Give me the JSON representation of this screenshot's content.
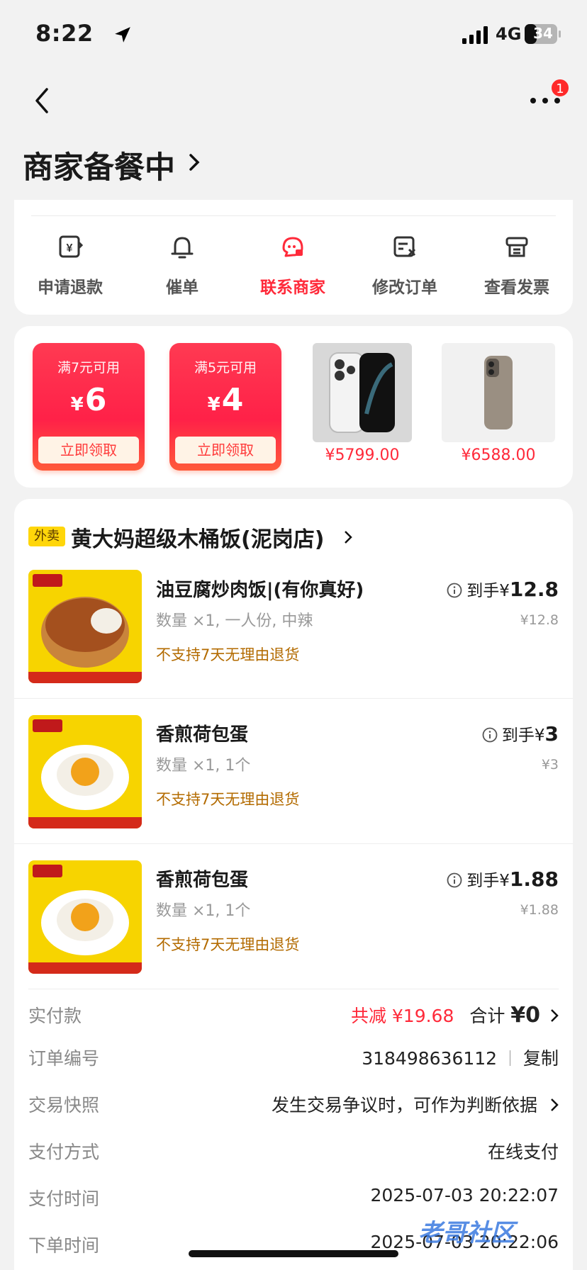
{
  "status_bar": {
    "time": "8:22",
    "network": "4G",
    "battery": "34"
  },
  "nav": {
    "badge_count": "1"
  },
  "header": {
    "title": "商家备餐中"
  },
  "actions": [
    {
      "label": "申请退款",
      "icon": "refund-icon"
    },
    {
      "label": "催单",
      "icon": "bell-icon"
    },
    {
      "label": "联系商家",
      "icon": "merchant-chat-icon"
    },
    {
      "label": "修改订单",
      "icon": "edit-order-icon"
    },
    {
      "label": "查看发票",
      "icon": "invoice-icon"
    }
  ],
  "promo": {
    "coupons": [
      {
        "condition": "满7元可用",
        "currency": "¥",
        "amount": "6",
        "button": "立即领取"
      },
      {
        "condition": "满5元可用",
        "currency": "¥",
        "amount": "4",
        "button": "立即领取"
      }
    ],
    "products": [
      {
        "price": "¥5799.00"
      },
      {
        "price": "¥6588.00"
      }
    ]
  },
  "order": {
    "tag": "外卖",
    "shop_name": "黄大妈超级木桶饭(泥岗店)",
    "items": [
      {
        "name": "油豆腐炒肉饭|(有你真好)",
        "spec": "数量 ×1, 一人份, 中辣",
        "policy": "不支持7天无理由退货",
        "final_label": "到手",
        "final_currency": "¥",
        "final_price": "12.8",
        "price": "¥12.8"
      },
      {
        "name": "香煎荷包蛋",
        "spec": "数量 ×1, 1个",
        "policy": "不支持7天无理由退货",
        "final_label": "到手",
        "final_currency": "¥",
        "final_price": "3",
        "price": "¥3"
      },
      {
        "name": "香煎荷包蛋",
        "spec": "数量 ×1, 1个",
        "policy": "不支持7天无理由退货",
        "final_label": "到手",
        "final_currency": "¥",
        "final_price": "1.88",
        "price": "¥1.88"
      }
    ],
    "details": {
      "paid_label": "实付款",
      "discount_text": "共减 ¥19.68",
      "total_label": "合计",
      "total_value": "¥0",
      "order_no_label": "订单编号",
      "order_no": "318498636112",
      "copy_label": "复制",
      "snapshot_label": "交易快照",
      "snapshot_text": "发生交易争议时，可作为判断依据",
      "pay_method_label": "支付方式",
      "pay_method": "在线支付",
      "pay_time_label": "支付时间",
      "pay_time": "2025-07-03 20:22:07",
      "order_time_label": "下单时间",
      "order_time": "2025-07-03 20:22:06"
    }
  },
  "watermark": "老哥社区",
  "colors": {
    "accent": "#ff2a3a",
    "policy": "#b36b00",
    "tag": "#ffd60a"
  }
}
